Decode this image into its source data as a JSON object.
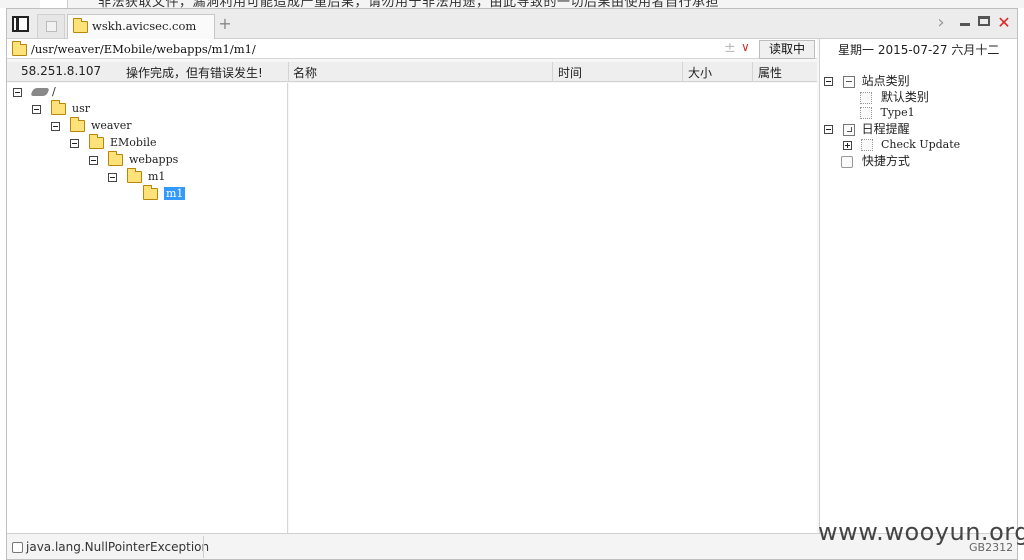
{
  "background_page": {
    "partial_text": "非法获取文件，漏洞利用可能造成严重后果，请勿用于非法用途，由此导致的一切后果由使用者自行承担"
  },
  "window": {
    "tabs": [
      {
        "label": "wskh.avicsec.com",
        "active": true
      }
    ],
    "new_tab_label": "+"
  },
  "address_bar": {
    "path": "/usr/weaver/EMobile/webapps/m1/m1/",
    "sort_icon": "±",
    "dropdown_icon": "∨",
    "read_button_label": "读取中"
  },
  "status_row": {
    "ip": "58.251.8.107",
    "message": "操作完成，但有错误发生!",
    "columns": [
      "名称",
      "时间",
      "大小",
      "属性"
    ]
  },
  "tree": {
    "root": "/",
    "nodes": [
      {
        "label": "usr",
        "depth": 1
      },
      {
        "label": "weaver",
        "depth": 2
      },
      {
        "label": "EMobile",
        "depth": 3
      },
      {
        "label": "webapps",
        "depth": 4
      },
      {
        "label": "m1",
        "depth": 5
      },
      {
        "label": "m1",
        "depth": 6,
        "selected": true
      }
    ]
  },
  "right_panel": {
    "date_line": "星期一 2015-07-27 六月十二",
    "items": [
      {
        "label": "站点类别",
        "icon": "category-icon",
        "expanded": true
      },
      {
        "label": "默认类别",
        "icon": "dotted-box-icon",
        "child": true
      },
      {
        "label": "Type1",
        "icon": "dotted-box-icon",
        "child": true
      },
      {
        "label": "日程提醒",
        "icon": "clock-icon",
        "expanded": true
      },
      {
        "label": "Check Update",
        "icon": "dotted-box-icon",
        "child": true,
        "collapsed": true
      },
      {
        "label": "快捷方式",
        "icon": "shortcut-icon"
      }
    ]
  },
  "bottom_bar": {
    "error_text": "java.lang.NullPointerException",
    "encoding": "GB2312"
  },
  "watermark": "www.wooyun.org",
  "colors": {
    "selection": "#3399ff",
    "folder": "#fde27a",
    "close": "#dd2222"
  }
}
